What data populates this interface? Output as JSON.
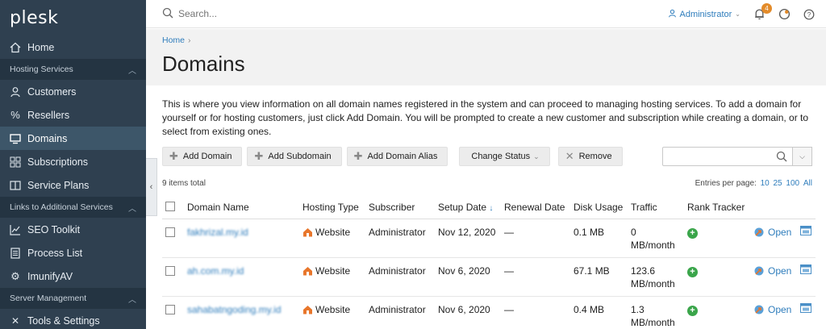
{
  "sidebar": {
    "logo": "plesk",
    "home": "Home",
    "sections": [
      {
        "label": "Hosting Services",
        "items": [
          "Customers",
          "Resellers",
          "Domains",
          "Subscriptions",
          "Service Plans"
        ]
      },
      {
        "label": "Links to Additional Services",
        "items": [
          "SEO Toolkit",
          "Process List",
          "ImunifyAV"
        ]
      },
      {
        "label": "Server Management",
        "items": [
          "Tools & Settings"
        ]
      }
    ],
    "active": "Domains"
  },
  "topbar": {
    "search_placeholder": "Search...",
    "user": "Administrator",
    "notifications_count": "4"
  },
  "breadcrumb": "Home",
  "page_title": "Domains",
  "description": "This is where you view information on all domain names registered in the system and can proceed to managing hosting services. To add a domain for yourself or for hosting customers, just click Add Domain. You will be prompted to create a new customer and subscription while creating a domain, or to select from existing ones.",
  "toolbar": {
    "add_domain": "Add Domain",
    "add_subdomain": "Add Subdomain",
    "add_alias": "Add Domain Alias",
    "change_status": "Change Status",
    "remove": "Remove"
  },
  "items_count": "9 items total",
  "per_page": {
    "label": "Entries per page:",
    "options": [
      "10",
      "25",
      "100",
      "All"
    ]
  },
  "table": {
    "headers": [
      "Domain Name",
      "Hosting Type",
      "Subscriber",
      "Setup Date",
      "Renewal Date",
      "Disk Usage",
      "Traffic",
      "Rank Tracker"
    ],
    "rows": [
      {
        "domain": "fakhrizal.my.id",
        "hosting": "Website",
        "subscriber": "Administrator",
        "setup": "Nov 12, 2020",
        "renewal": "—",
        "disk": "0.1 MB",
        "traffic": "0 MB/month",
        "open": "Open"
      },
      {
        "domain": "ah.com.my.id",
        "hosting": "Website",
        "subscriber": "Administrator",
        "setup": "Nov 6, 2020",
        "renewal": "—",
        "disk": "67.1 MB",
        "traffic": "123.6 MB/month",
        "open": "Open"
      },
      {
        "domain": "sahabatngoding.my.id",
        "hosting": "Website",
        "subscriber": "Administrator",
        "setup": "Nov 6, 2020",
        "renewal": "—",
        "disk": "0.4 MB",
        "traffic": "1.3 MB/month",
        "open": "Open"
      }
    ]
  }
}
